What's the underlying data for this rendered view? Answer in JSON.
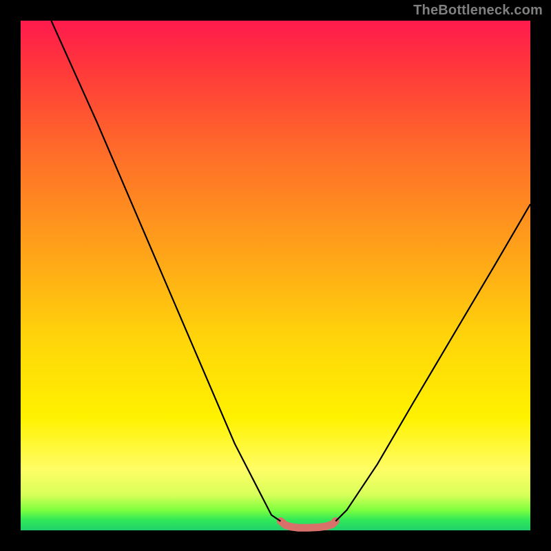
{
  "watermark": "TheBottleneck.com",
  "chart_data": {
    "type": "line",
    "title": "",
    "xlabel": "",
    "ylabel": "",
    "xlim": [
      0,
      1
    ],
    "ylim": [
      0,
      1
    ],
    "series": [
      {
        "name": "left-curve",
        "x": [
          0.06,
          0.15,
          0.24,
          0.33,
          0.42,
          0.492,
          0.51
        ],
        "y": [
          1.0,
          0.8,
          0.59,
          0.38,
          0.17,
          0.03,
          0.018
        ]
      },
      {
        "name": "right-curve",
        "x": [
          0.618,
          0.64,
          0.7,
          0.77,
          0.85,
          0.93,
          1.0
        ],
        "y": [
          0.018,
          0.04,
          0.13,
          0.25,
          0.385,
          0.52,
          0.64
        ]
      },
      {
        "name": "flat-bottom",
        "x": [
          0.51,
          0.52,
          0.53,
          0.545,
          0.565,
          0.585,
          0.6,
          0.612,
          0.618
        ],
        "y": [
          0.018,
          0.01,
          0.007,
          0.005,
          0.005,
          0.006,
          0.008,
          0.012,
          0.018
        ]
      }
    ],
    "annotations": {
      "flat_region_x": [
        0.5,
        0.628
      ],
      "flat_region_color": "#d9716b",
      "flat_region_stroke_width": 11
    }
  }
}
